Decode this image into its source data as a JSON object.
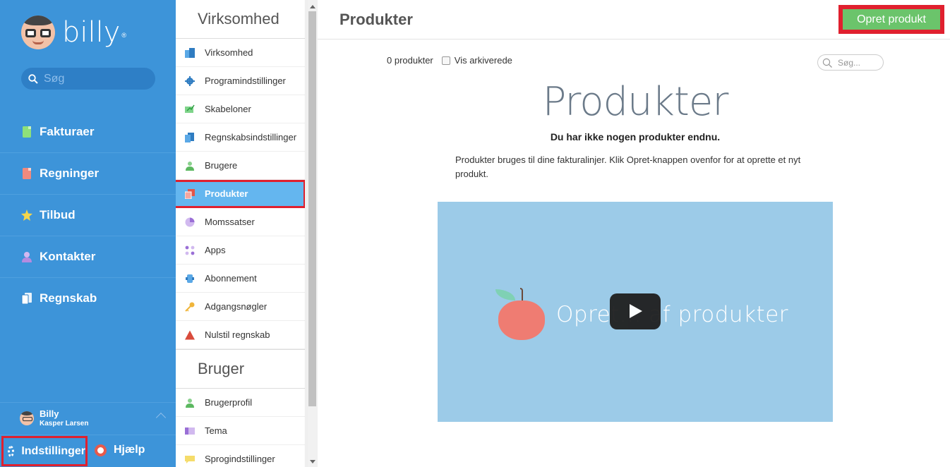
{
  "app": {
    "logo_text": "billy",
    "logo_reg": "®"
  },
  "sidebar": {
    "search_placeholder": "Søg",
    "items": [
      {
        "label": "Fakturaer",
        "icon": "invoice-icon",
        "color": "#8ee07a"
      },
      {
        "label": "Regninger",
        "icon": "bill-icon",
        "color": "#f08a7e"
      },
      {
        "label": "Tilbud",
        "icon": "star-icon",
        "color": "#f5d64a"
      },
      {
        "label": "Kontakter",
        "icon": "person-icon",
        "color": "#b58be0"
      },
      {
        "label": "Regnskab",
        "icon": "ledger-icon",
        "color": "#e9f3fb"
      }
    ],
    "user": {
      "org": "Billy",
      "name": "Kasper Larsen"
    },
    "settings_label": "Indstillinger",
    "help_label": "Hjælp"
  },
  "settings_menu": {
    "company_title": "Virksomhed",
    "company_items": [
      {
        "label": "Virksomhed",
        "icon": "building-icon"
      },
      {
        "label": "Programindstillinger",
        "icon": "gear-icon"
      },
      {
        "label": "Skabeloner",
        "icon": "template-icon"
      },
      {
        "label": "Regnskabsindstillinger",
        "icon": "ledger-icon"
      },
      {
        "label": "Brugere",
        "icon": "users-icon"
      },
      {
        "label": "Produkter",
        "icon": "products-icon",
        "active": true
      },
      {
        "label": "Momssatser",
        "icon": "pie-icon"
      },
      {
        "label": "Apps",
        "icon": "apps-icon"
      },
      {
        "label": "Abonnement",
        "icon": "subscription-icon"
      },
      {
        "label": "Adgangsnøgler",
        "icon": "key-icon"
      },
      {
        "label": "Nulstil regnskab",
        "icon": "warning-icon"
      }
    ],
    "user_title": "Bruger",
    "user_items": [
      {
        "label": "Brugerprofil",
        "icon": "profile-icon"
      },
      {
        "label": "Tema",
        "icon": "theme-icon"
      },
      {
        "label": "Sprogindstillinger",
        "icon": "language-icon"
      }
    ]
  },
  "main": {
    "title": "Produkter",
    "create_button": "Opret produkt",
    "count_text": "0 produkter",
    "archived_label": "Vis arkiverede",
    "search_placeholder": "Søg...",
    "empty_title": "Produkter",
    "empty_subtitle": "Du har ikke nogen produkter endnu.",
    "empty_description": "Produkter bruges til dine fakturalinjer. Klik Opret-knappen ovenfor for at oprette et nyt produkt.",
    "video_caption": "Opret... af produkter"
  }
}
